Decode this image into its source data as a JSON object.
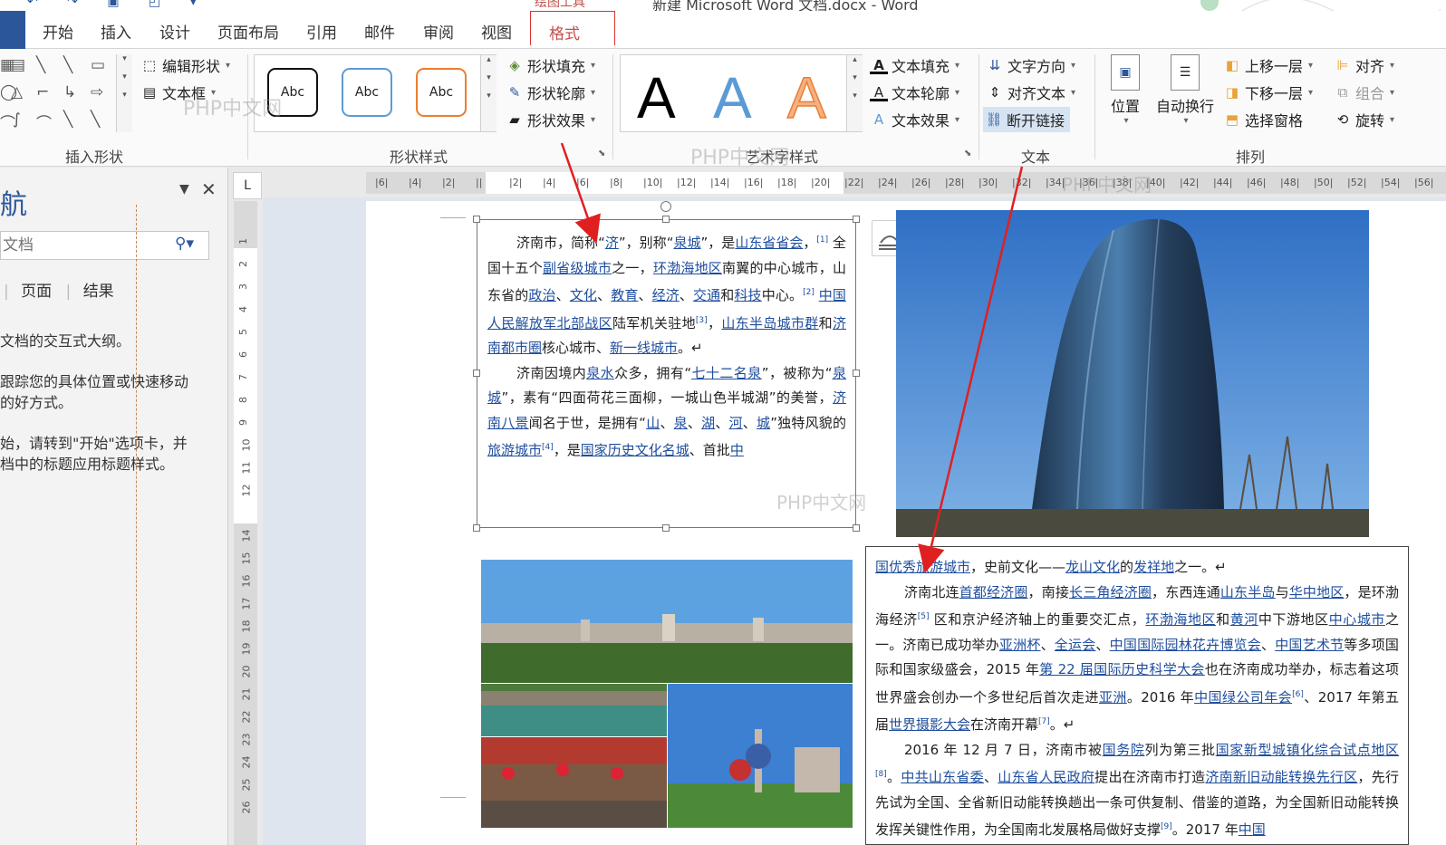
{
  "window": {
    "title": "新建 Microsoft Word 文档.docx - Word",
    "context_tab_label": "绘图工具"
  },
  "tabs": [
    "开始",
    "插入",
    "设计",
    "页面布局",
    "引用",
    "邮件",
    "审阅",
    "视图"
  ],
  "active_tab": "格式",
  "ribbon": {
    "insert_shapes": {
      "label": "插入形状",
      "edit_shape": "编辑形状",
      "text_box": "文本框"
    },
    "shape_styles": {
      "label": "形状样式",
      "style_samples": [
        "Abc",
        "Abc",
        "Abc"
      ],
      "fill": "形状填充",
      "outline": "形状轮廓",
      "effects": "形状效果"
    },
    "wordart_styles": {
      "label": "艺术字样式",
      "samples": [
        "A",
        "A",
        "A"
      ],
      "text_fill": "文本填充",
      "text_outline": "文本轮廓",
      "text_effects": "文本效果"
    },
    "text": {
      "label": "文本",
      "direction": "文字方向",
      "align": "对齐文本",
      "break_link": "断开链接"
    },
    "arrange": {
      "label": "排列",
      "position": "位置",
      "wrap": "自动换行",
      "bring_forward": "上移一层",
      "send_backward": "下移一层",
      "selection_pane": "选择窗格",
      "align": "对齐",
      "group": "组合",
      "rotate": "旋转"
    }
  },
  "watermark_text": "PHP中文网",
  "nav_pane": {
    "title": "航",
    "search_placeholder": "文档",
    "tabs": [
      "页面",
      "结果"
    ],
    "help_lines": [
      "文档的交互式大纲。",
      "跟踪您的具体位置或快速移动",
      "的好方式。",
      "始，请转到\"开始\"选项卡，并",
      "档中的标题应用标题样式。"
    ]
  },
  "ruler": {
    "corner": "L",
    "h_ticks": [
      "6",
      "4",
      "2",
      "",
      "2",
      "4",
      "6",
      "8",
      "10",
      "12",
      "14",
      "16",
      "18",
      "20",
      "22",
      "24",
      "26",
      "28",
      "30",
      "32",
      "34",
      "36",
      "38",
      "40",
      "42",
      "44",
      "46",
      "48",
      "50",
      "52",
      "54",
      "56"
    ],
    "v_ticks": [
      "1",
      "2",
      "3",
      "4",
      "5",
      "6",
      "7",
      "8",
      "9",
      "10",
      "11",
      "12",
      "",
      "14",
      "15",
      "16",
      "17",
      "18",
      "19",
      "20",
      "21",
      "22",
      "23",
      "24",
      "25",
      "26"
    ]
  },
  "colors": {
    "accent": "#2b579a",
    "link": "#1f4e9e",
    "context": "#c0504d",
    "arrow": "#e02020"
  }
}
